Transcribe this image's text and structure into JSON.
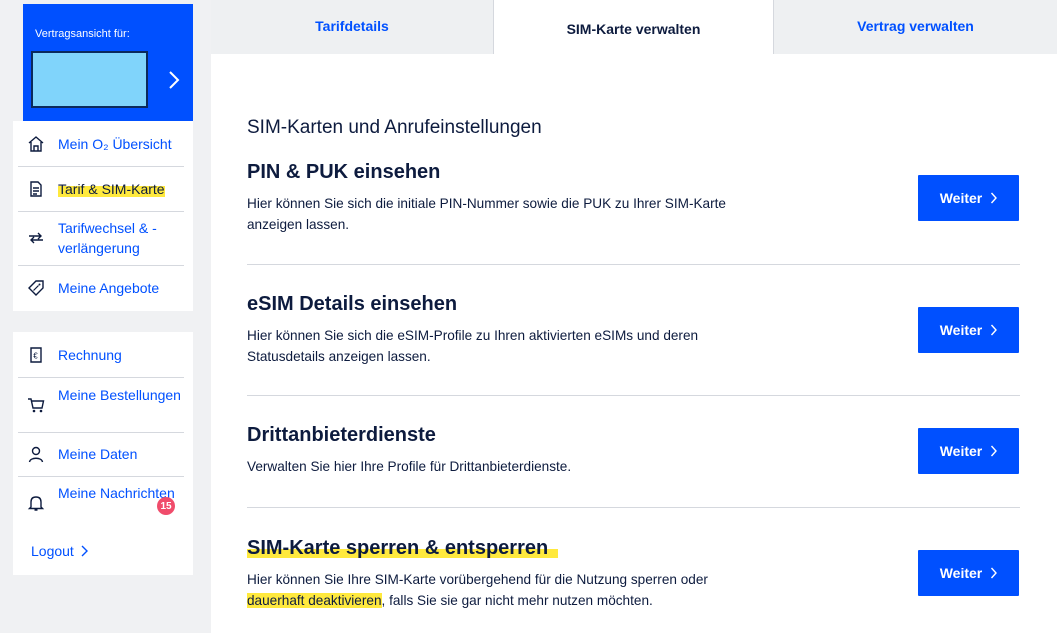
{
  "sidebar": {
    "contract_card": {
      "label": "Vertragsansicht für:"
    },
    "group1": [
      {
        "name": "nav-overview",
        "label": "Mein O₂ Übersicht",
        "icon": "home-icon",
        "active": false
      },
      {
        "name": "nav-tariff-sim",
        "label": "Tarif & SIM-Karte",
        "icon": "document-icon",
        "active": true
      },
      {
        "name": "nav-tariff-change",
        "label": "Tarifwechsel & -verlängerung",
        "icon": "swap-arrows-icon",
        "active": false
      },
      {
        "name": "nav-offers",
        "label": "Meine Angebote",
        "icon": "tag-icon",
        "active": false
      }
    ],
    "group2": [
      {
        "name": "nav-invoice",
        "label": "Rechnung",
        "icon": "invoice-icon"
      },
      {
        "name": "nav-orders",
        "label": "Meine Bestellungen",
        "icon": "cart-icon"
      },
      {
        "name": "nav-data",
        "label": "Meine Daten",
        "icon": "person-icon"
      },
      {
        "name": "nav-messages",
        "label": "Meine Nachrichten",
        "icon": "bell-icon",
        "badge": "15"
      }
    ],
    "logout_label": "Logout"
  },
  "tabs": [
    {
      "label": "Tarifdetails",
      "active": false
    },
    {
      "label": "SIM-Karte verwalten",
      "active": true
    },
    {
      "label": "Vertrag verwalten",
      "active": false
    }
  ],
  "main": {
    "section_title": "SIM-Karten und Anrufeinstellungen",
    "button_label": "Weiter",
    "items": [
      {
        "title": "PIN & PUK einsehen",
        "text": "Hier können Sie sich die initiale PIN-Nummer sowie die PUK zu Ihrer SIM-Karte anzeigen lassen."
      },
      {
        "title": "eSIM Details einsehen",
        "text": "Hier können Sie sich die eSIM-Profile zu Ihren aktivierten eSIMs und deren Statusdetails anzeigen lassen."
      },
      {
        "title": "Drittanbieterdienste",
        "text": "Verwalten Sie hier Ihre Profile für Drittanbieterdienste."
      },
      {
        "title": "SIM-Karte sperren & entsperren",
        "text_before": "Hier können Sie Ihre SIM-Karte vorübergehend für die Nutzung sperren oder ",
        "text_highlight": "dauerhaft deaktivieren",
        "text_after": ", falls Sie sie gar nicht mehr nutzen möchten."
      }
    ]
  },
  "colors": {
    "brand_blue": "#0050ff",
    "highlight_yellow": "#ffe93d",
    "badge_red": "#f04c6b",
    "text_dark": "#0d1b3e"
  }
}
